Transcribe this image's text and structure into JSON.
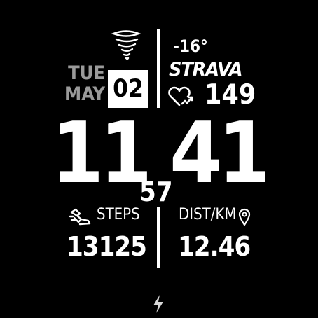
{
  "date": {
    "weekday": "TUE",
    "month": "MAY",
    "day": "02"
  },
  "weather": {
    "icon": "tornado-icon",
    "temperature": "-16°"
  },
  "brand": {
    "name": "STRAVA"
  },
  "heart_rate": {
    "icon": "heart-rate-icon",
    "value": "149"
  },
  "time": {
    "hours": "11",
    "minutes": "41",
    "seconds": "57"
  },
  "steps": {
    "icon": "steps-icon",
    "label": "STEPS",
    "value": "13125"
  },
  "distance": {
    "icon": "location-pin-icon",
    "label": "DIST/KM",
    "value": "12.46"
  },
  "status": {
    "icon": "bolt-icon"
  },
  "colors": {
    "background": "#000000",
    "foreground": "#ffffff",
    "date_text": "#9a9a9a"
  }
}
